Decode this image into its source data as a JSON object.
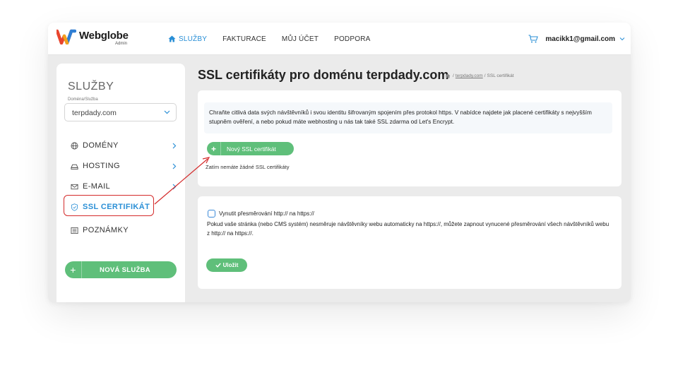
{
  "brand": {
    "name": "Webglobe",
    "sub": "Admin"
  },
  "nav": {
    "items": [
      {
        "label": "SLUŽBY",
        "active": true
      },
      {
        "label": "FAKTURACE",
        "active": false
      },
      {
        "label": "MŮJ ÚČET",
        "active": false
      },
      {
        "label": "PODPORA",
        "active": false
      }
    ],
    "user_email": "macikk1@gmail.com"
  },
  "sidebar": {
    "title": "SLUŽBY",
    "select_label": "Doména/Služba",
    "select_value": "terpdady.com",
    "items": [
      {
        "label": "DOMÉNY",
        "icon": "globe-icon"
      },
      {
        "label": "HOSTING",
        "icon": "hosting-icon"
      },
      {
        "label": "E-MAIL",
        "icon": "mail-icon"
      },
      {
        "label": "SSL CERTIFIKÁT",
        "icon": "shield-icon"
      },
      {
        "label": "POZNÁMKY",
        "icon": "notes-icon"
      }
    ],
    "new_service": "NOVÁ SLUŽBA"
  },
  "main": {
    "title": "SSL certifikáty pro doménu terpdady.com",
    "breadcrumb": {
      "sep": "/",
      "link": "terpdady.com",
      "current": "SSL certifikát"
    },
    "info_text": "Chraňte citlivá data svých návštěvníků i svou identitu šifrovaným spojením přes protokol https. V nabídce najdete jak placené certifikáty s nejvyšším stupněm ověření, a nebo pokud máte webhosting u nás tak také SSL zdarma od Let's Encrypt.",
    "new_ssl_button": "Nový SSL certifikát",
    "no_certs": "Zatím nemáte žádné SSL certifikáty",
    "redirect_label": "Vynutit přesměrování http:// na https://",
    "redirect_desc": "Pokud vaše stránka (nebo CMS systém) nesměruje návštěvníky webu automaticky na https://, můžete zapnout vynucené přesměrování všech návštěvníků webu z http:// na https://.",
    "save_button": "Uložit"
  },
  "colors": {
    "accent": "#2a8fd6",
    "green": "#5fbf7a",
    "highlight": "#d42b2b"
  }
}
